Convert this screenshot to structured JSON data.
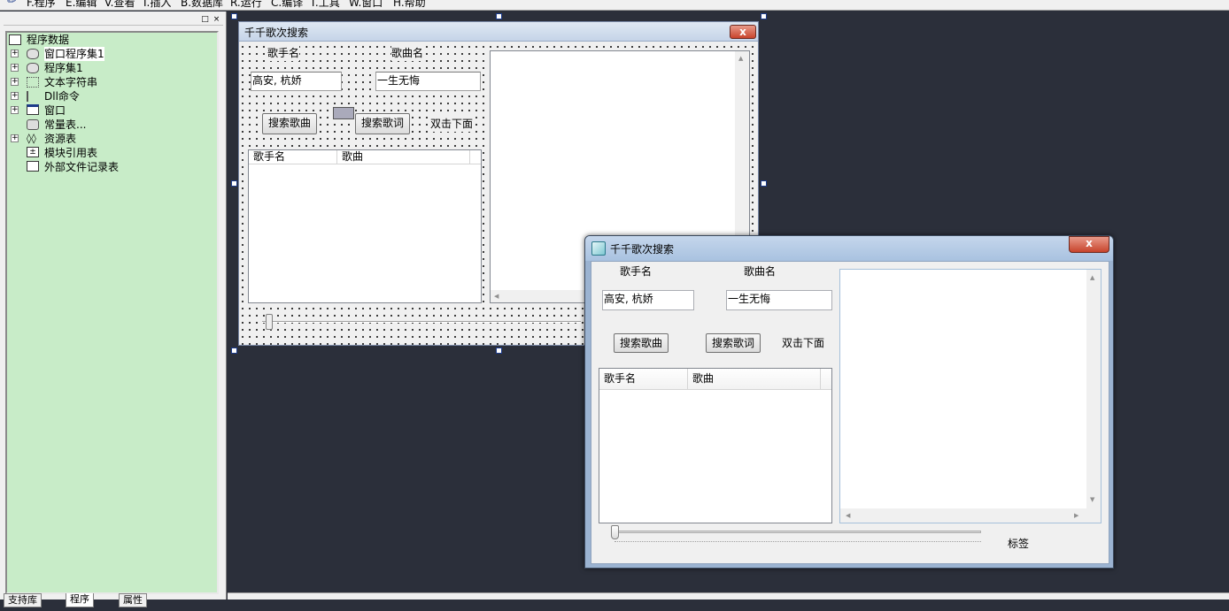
{
  "menu": [
    "F.程序",
    "E.编辑",
    "V.查看",
    "I.插入",
    "B.数据库",
    "R.运行",
    "C.编译",
    "T.工具",
    "W.窗口",
    "H.帮助"
  ],
  "left_panel": {
    "pin_label": "□",
    "close_label": "×",
    "root": "程序数据",
    "items": [
      "窗口程序集1",
      "程序集1",
      "文本字符串",
      "Dll命令",
      "窗口",
      "常量表...",
      "资源表",
      "模块引用表",
      "外部文件记录表"
    ],
    "tabs": [
      "支持库",
      "程序",
      "属性"
    ]
  },
  "designer": {
    "title": "千千歌次搜索",
    "close": "x",
    "label_singer": "歌手名",
    "label_song": "歌曲名",
    "input_singer": "高安, 杭娇",
    "input_song": "一生无悔",
    "btn_search_song": "搜索歌曲",
    "btn_search_lyrics": "搜索歌词",
    "label_dblclick": "双击下面",
    "col_singer": "歌手名",
    "col_song": "歌曲"
  },
  "running": {
    "title": "千千歌次搜索",
    "close": "x",
    "label_singer": "歌手名",
    "label_song": "歌曲名",
    "input_singer": "高安, 杭娇",
    "input_song": "一生无悔",
    "btn_search_song": "搜索歌曲",
    "btn_search_lyrics": "搜索歌词",
    "label_dblclick": "双击下面",
    "col_singer": "歌手名",
    "col_song": "歌曲",
    "slider_value": 0,
    "label_tag": "标签"
  },
  "colors": {
    "workspace": "#2b2f3a",
    "tree_bg": "#c8ecc8",
    "close_red": "#c8442c",
    "title_blue": "#a9c2e0"
  }
}
